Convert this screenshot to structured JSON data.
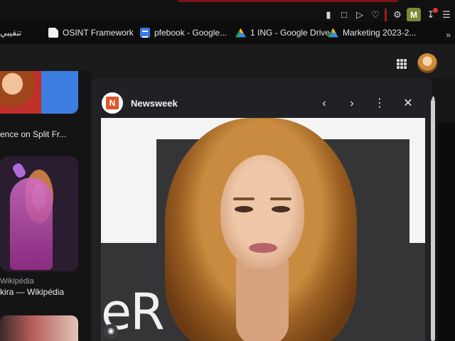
{
  "toolbar": {
    "extensions": [
      "pin-icon",
      "crop-icon",
      "play-icon",
      "heart-icon",
      "puzzle-icon",
      "profile-badge",
      "download-icon",
      "menu-icon"
    ],
    "profile_badge_letter": "M"
  },
  "bookmarks": [
    {
      "label": "تنقيبي",
      "icon": "doc-icon"
    },
    {
      "label": "OSINT Framework",
      "icon": "doc-icon"
    },
    {
      "label": "pfebook - Google...",
      "icon": "google-docs-icon"
    },
    {
      "label": "1 ING - Google Drive",
      "icon": "google-drive-icon"
    },
    {
      "label": "Marketing 2023-2...",
      "icon": "google-drive-icon"
    }
  ],
  "bookmarks_more": "»",
  "results": {
    "caption1": "ence on Split Fr...",
    "card2_source": "Wikipédia",
    "card2_title": "kira — Wikipédia"
  },
  "panel": {
    "site_name": "Newsweek",
    "hero_text": "eR"
  },
  "colors": {
    "accent_red": "#a31919",
    "panel_bg": "#202124",
    "newsweek_logo": "#e0552a"
  }
}
